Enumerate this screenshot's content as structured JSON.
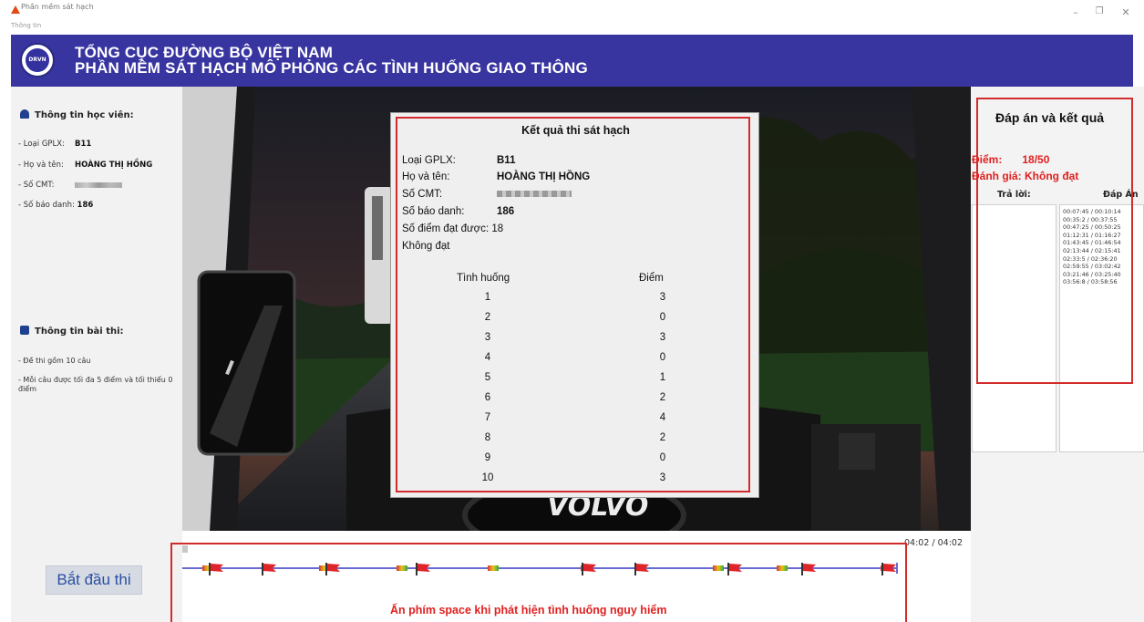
{
  "window": {
    "title": "Phần mềm sát hạch",
    "menu_item": "Thông tin",
    "controls": {
      "minimize": "–",
      "maximize": "❐",
      "close": "✕"
    }
  },
  "header": {
    "line1": "TỔNG CỤC ĐƯỜNG BỘ VIỆT NAM",
    "line2": "PHẦN MỀM SÁT HẠCH MÔ PHỎNG CÁC TÌNH HUỐNG GIAO THÔNG",
    "logo_text": "DRVN"
  },
  "student": {
    "heading": "Thông tin học viên:",
    "license_label": "- Loại GPLX:",
    "license_value": "B11",
    "name_label": "- Họ và tên:",
    "name_value": "HOÀNG THỊ HỒNG",
    "id_label": "- Số CMT:",
    "sbd_label": "- Số báo danh:",
    "sbd_value": "186"
  },
  "exam_info": {
    "heading": "Thông tin bài thi:",
    "note1": "- Đề thi gồm 10 câu",
    "note2": "- Mỗi câu được tối đa 5 điểm và tối thiểu 0 điểm"
  },
  "start_button": "Bắt đầu thi",
  "result_dialog": {
    "title": "Kết quả thi sát hạch",
    "license_label": "Loại GPLX:",
    "license_value": "B11",
    "name_label": "Họ và tên:",
    "name_value": "HOÀNG THỊ HỒNG",
    "id_label": "Số CMT:",
    "sbd_label": "Số báo danh:",
    "sbd_value": "186",
    "points_label": "Số điểm đạt được:",
    "points_value": "18",
    "verdict": "Không đạt",
    "col_situation": "Tình huống",
    "col_score": "Điểm",
    "rows": [
      {
        "situation": "1",
        "score": "3"
      },
      {
        "situation": "2",
        "score": "0"
      },
      {
        "situation": "3",
        "score": "3"
      },
      {
        "situation": "4",
        "score": "0"
      },
      {
        "situation": "5",
        "score": "1"
      },
      {
        "situation": "6",
        "score": "2"
      },
      {
        "situation": "7",
        "score": "4"
      },
      {
        "situation": "8",
        "score": "2"
      },
      {
        "situation": "9",
        "score": "0"
      },
      {
        "situation": "10",
        "score": "3"
      }
    ]
  },
  "results_panel": {
    "title": "Đáp án và kết quả",
    "score_label": "Điểm:",
    "score_value": "18/50",
    "eval_label": "Đánh giá:",
    "eval_value": "Không đạt",
    "col_answer": "Trả lời:",
    "col_key": "Đáp Án",
    "answers": [],
    "key_items": [
      "00:07:45 / 00:10:14",
      "00:35:2 / 00:37:55",
      "00:47:25 / 00:50:25",
      "01:12:31 / 01:16:27",
      "01:43:45 / 01:46:54",
      "02:13:44 / 02:15:41",
      "02:33:5 / 02:36:20",
      "02:59:55 / 03:02:42",
      "03:21:46 / 03:25:40",
      "03:56:8 / 03:58:56"
    ]
  },
  "timeline": {
    "time": "04:02 / 04:02",
    "progress": 1.0,
    "hint": "Ấn phím space khi phát hiện tình huống nguy hiểm",
    "track_color": "#6a6ad0",
    "flag_color": "#e0252a"
  },
  "video": {
    "dashboard_text": "VOLVO"
  },
  "colors": {
    "banner": "#3834a0",
    "highlight": "#d22b2b",
    "alert_text": "#e02020"
  }
}
